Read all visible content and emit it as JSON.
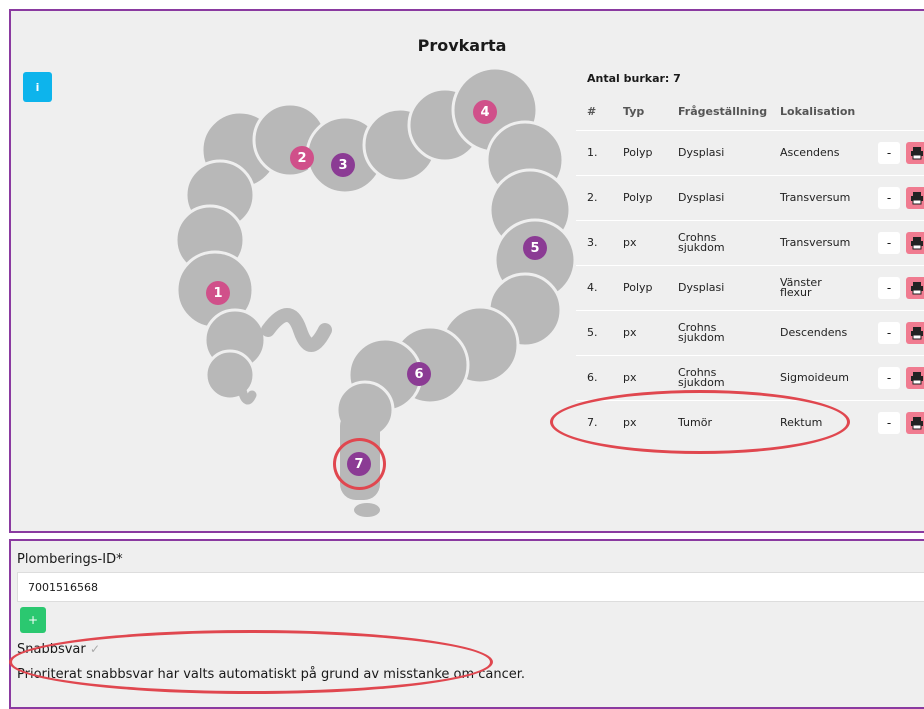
{
  "title": "Provkarta",
  "info_button": "i",
  "sample_count_label": "Antal burkar: 7",
  "table": {
    "headers": [
      "#",
      "Typ",
      "Frågeställning",
      "Lokalisation"
    ],
    "rows": [
      {
        "num": "1.",
        "typ": "Polyp",
        "fraga": "Dysplasi",
        "lok": "Ascendens"
      },
      {
        "num": "2.",
        "typ": "Polyp",
        "fraga": "Dysplasi",
        "lok": "Transversum"
      },
      {
        "num": "3.",
        "typ": "px",
        "fraga": "Crohns sjukdom",
        "lok": "Transversum"
      },
      {
        "num": "4.",
        "typ": "Polyp",
        "fraga": "Dysplasi",
        "lok": "Vänster flexur"
      },
      {
        "num": "5.",
        "typ": "px",
        "fraga": "Crohns sjukdom",
        "lok": "Descendens"
      },
      {
        "num": "6.",
        "typ": "px",
        "fraga": "Crohns sjukdom",
        "lok": "Sigmoideum"
      },
      {
        "num": "7.",
        "typ": "px",
        "fraga": "Tumör",
        "lok": "Rektum"
      }
    ],
    "minus_label": "-"
  },
  "markers": [
    {
      "label": "1",
      "color": "#d0508a"
    },
    {
      "label": "2",
      "color": "#d0508a"
    },
    {
      "label": "3",
      "color": "#8b3b94"
    },
    {
      "label": "4",
      "color": "#d0508a"
    },
    {
      "label": "5",
      "color": "#8b3b94"
    },
    {
      "label": "6",
      "color": "#8b3b94"
    },
    {
      "label": "7",
      "color": "#8b3b94"
    }
  ],
  "plombering": {
    "label": "Plomberings-ID*",
    "value": "7001516568",
    "add_label": "+"
  },
  "snabbsvar": {
    "label": "Snabbsvar",
    "checked": true,
    "notice": "Prioriterat snabbsvar har valts automatiskt på grund av misstanke om cancer."
  },
  "colors": {
    "panel_border": "#8a3aa0",
    "info": "#0db4ec",
    "add": "#2bc870",
    "printer": "#f07b90",
    "highlight": "#e0474f",
    "pink_marker": "#d0508a",
    "purple_marker": "#8b3b94"
  }
}
